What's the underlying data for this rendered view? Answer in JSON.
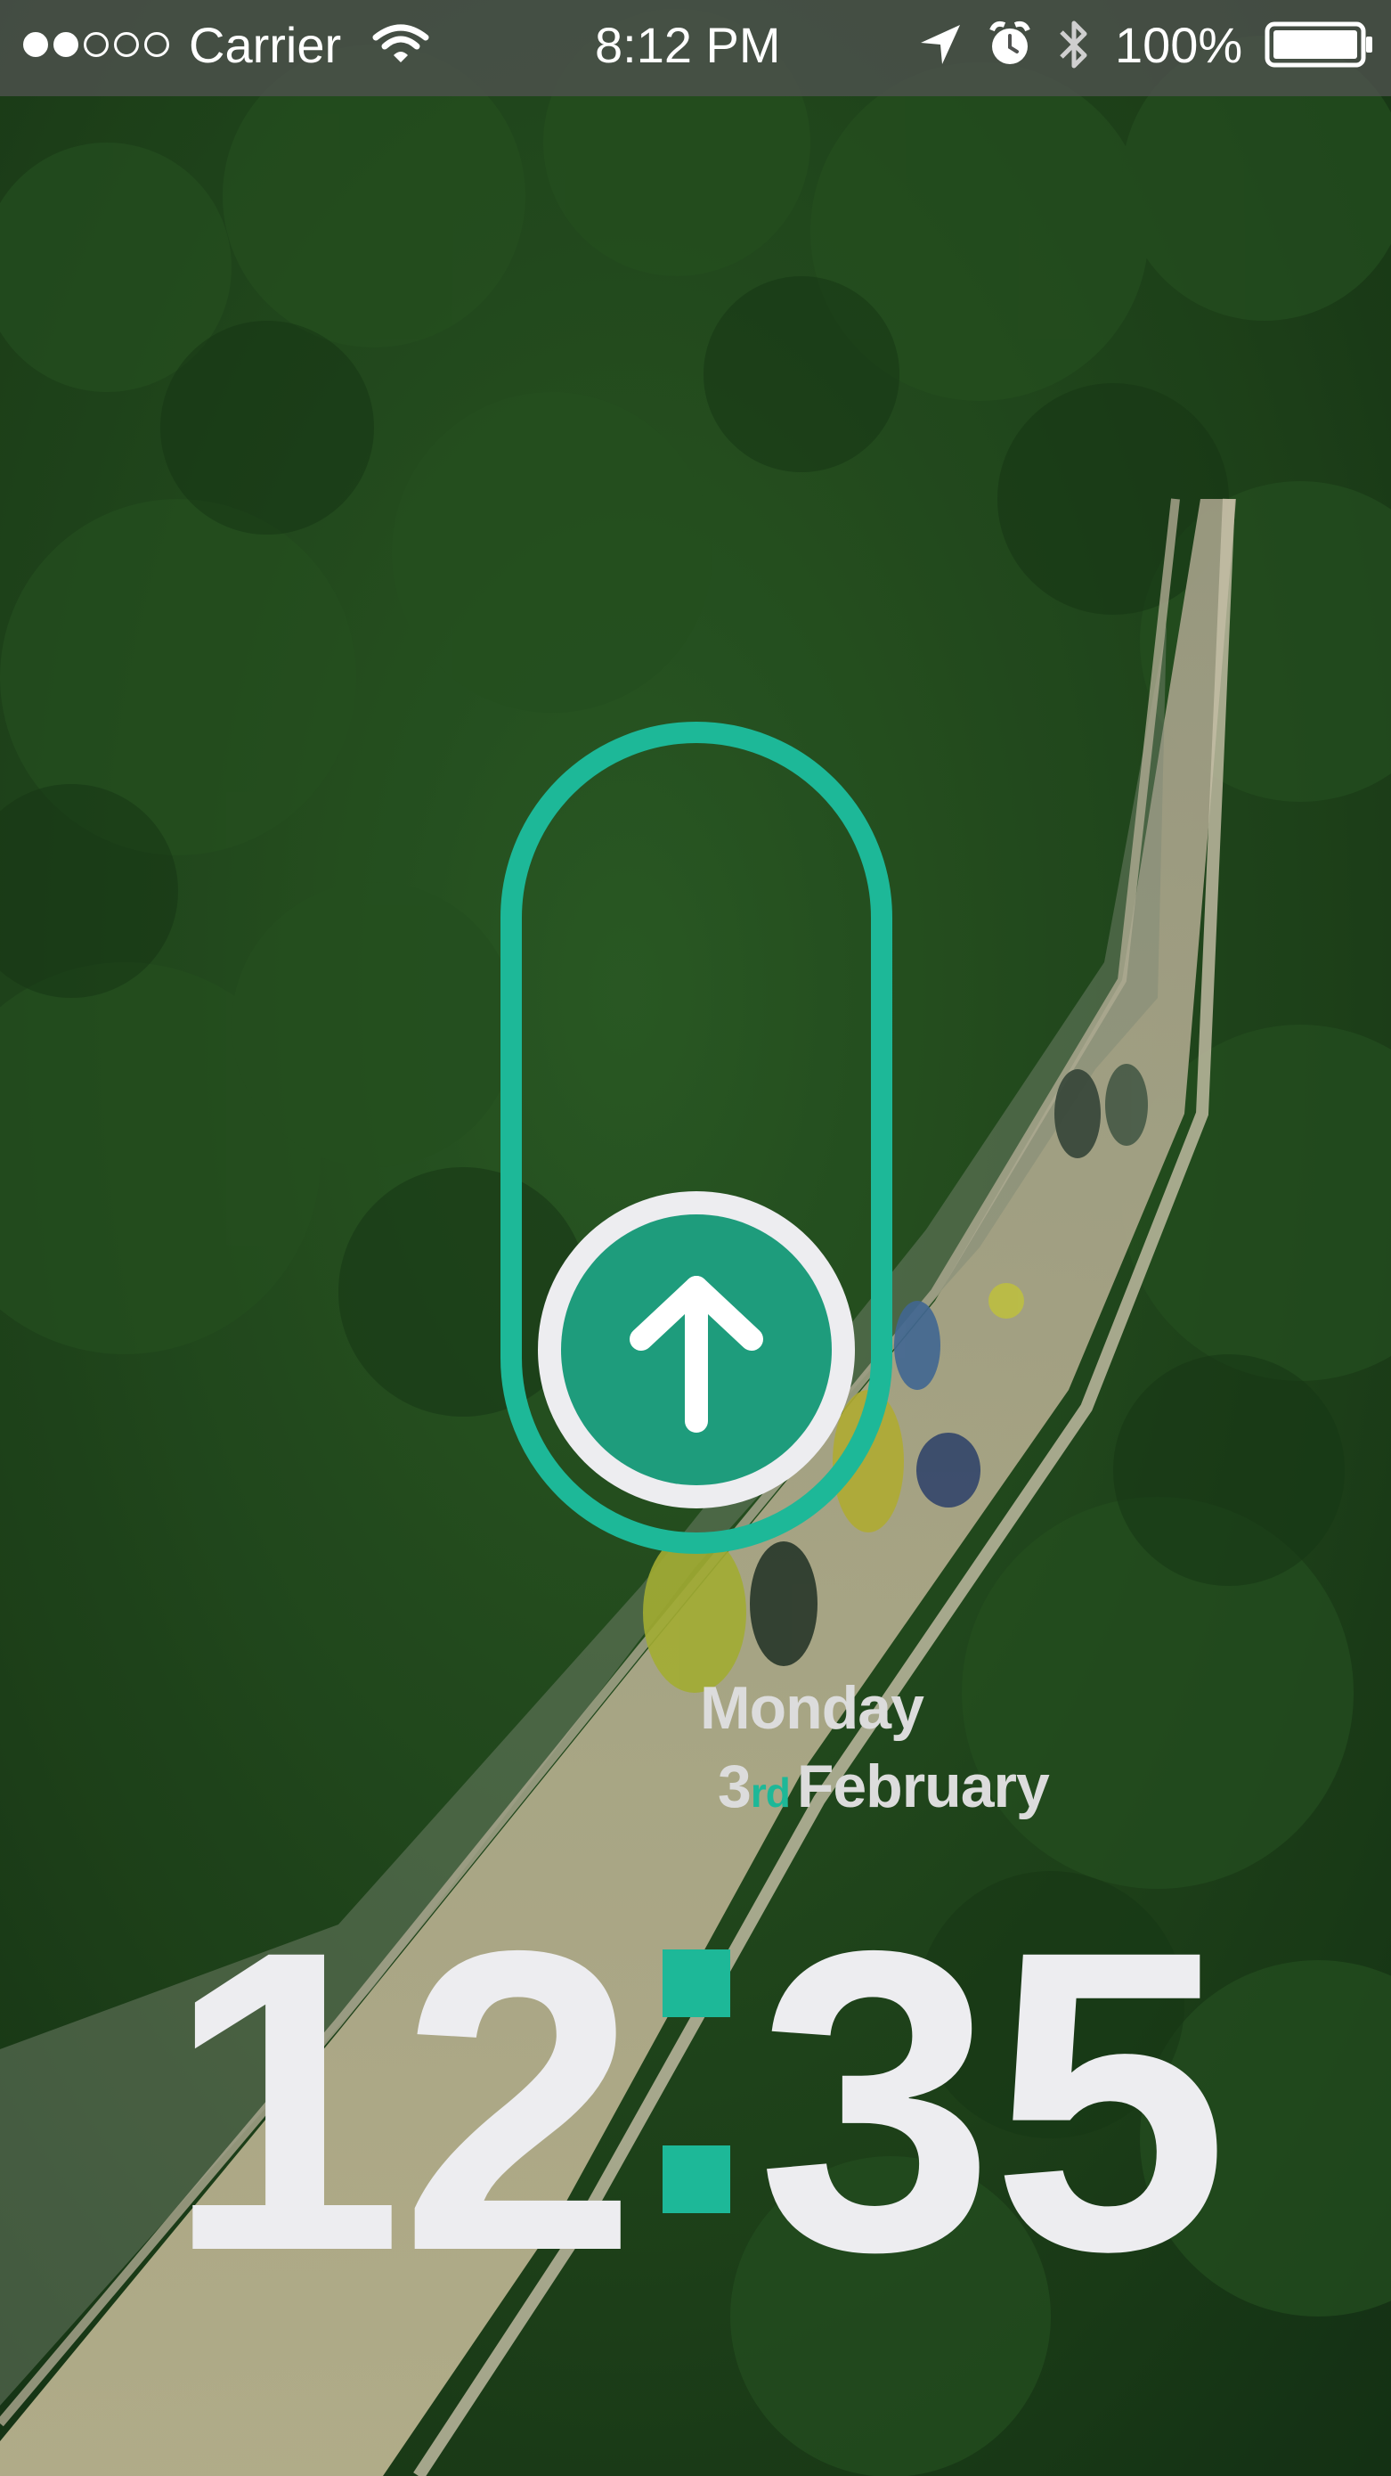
{
  "status_bar": {
    "signal_strength": 2,
    "signal_total": 5,
    "carrier": "Carrier",
    "time": "8:12 PM",
    "battery_percent": "100%",
    "icons": [
      "wifi-icon",
      "location-arrow-icon",
      "alarm-clock-icon",
      "bluetooth-icon",
      "battery-icon"
    ]
  },
  "lock_screen": {
    "slider_icon": "arrow-up-icon",
    "date": {
      "weekday": "Monday",
      "day": "3",
      "day_suffix": "rd",
      "month": "February"
    },
    "time": {
      "hours": "12",
      "minutes": "35"
    }
  },
  "colors": {
    "accent": "#1db898",
    "knob_fill": "#1e9c7c",
    "text_light": "#ededf0",
    "date_text": "#dcdcdc",
    "status_bar_bg": "#505250"
  }
}
